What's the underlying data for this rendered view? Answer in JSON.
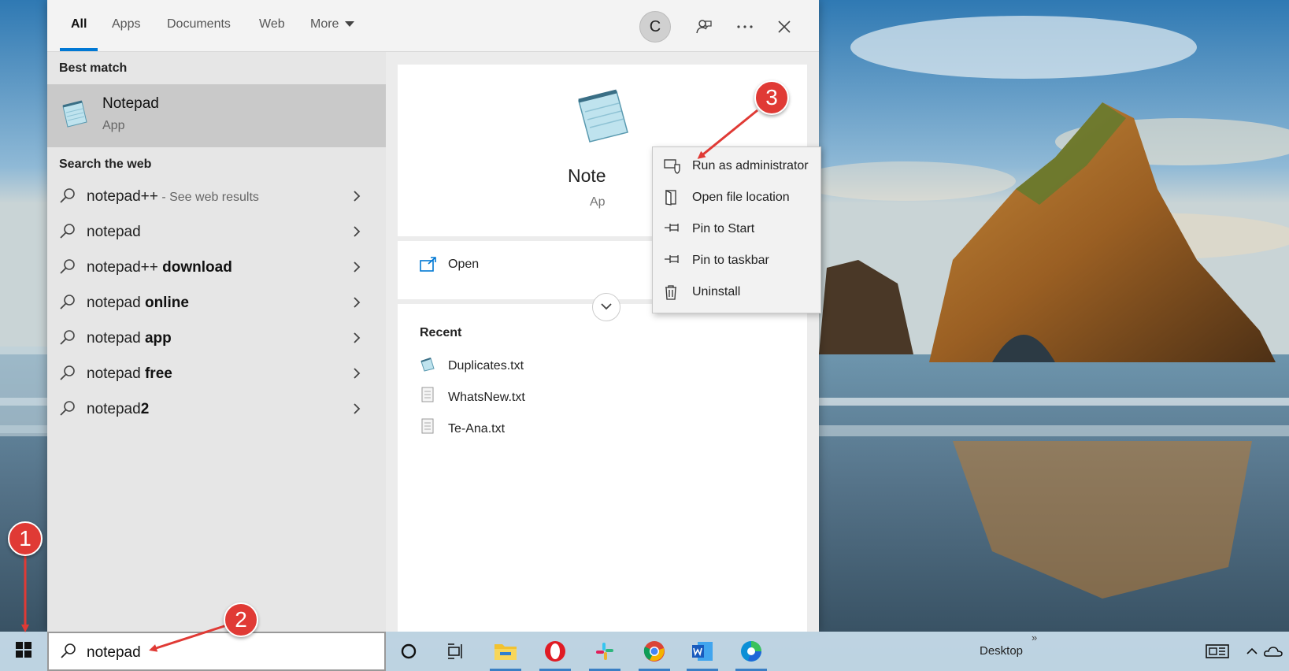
{
  "search_panel": {
    "tabs": [
      {
        "label": "All",
        "active": true
      },
      {
        "label": "Apps"
      },
      {
        "label": "Documents"
      },
      {
        "label": "Web"
      },
      {
        "label": "More"
      }
    ],
    "user_initial": "C",
    "best_match_heading": "Best match",
    "best_match": {
      "title": "Notepad",
      "subtitle": "App",
      "icon": "notepad-icon"
    },
    "search_web_heading": "Search the web",
    "web_results": [
      {
        "prefix": "notepad++",
        "bold": "",
        "hint": " - See web results"
      },
      {
        "prefix": "notepad",
        "bold": "",
        "hint": ""
      },
      {
        "prefix": "notepad++ ",
        "bold": "download",
        "hint": ""
      },
      {
        "prefix": "notepad ",
        "bold": "online",
        "hint": ""
      },
      {
        "prefix": "notepad ",
        "bold": "app",
        "hint": ""
      },
      {
        "prefix": "notepad ",
        "bold": "free",
        "hint": ""
      },
      {
        "prefix": "notepad",
        "bold": "2",
        "hint": ""
      }
    ]
  },
  "preview": {
    "app_name": "Note",
    "app_type": "Ap",
    "open_label": "Open",
    "recent_heading": "Recent",
    "recent_files": [
      {
        "name": "Duplicates.txt",
        "icon": "notepad-file-icon"
      },
      {
        "name": "WhatsNew.txt",
        "icon": "text-file-icon"
      },
      {
        "name": "Te-Ana.txt",
        "icon": "text-file-icon"
      }
    ]
  },
  "context_menu": {
    "items": [
      {
        "label": "Run as administrator",
        "icon": "shield-icon"
      },
      {
        "label": "Open file location",
        "icon": "folder-location-icon"
      },
      {
        "label": "Pin to Start",
        "icon": "pin-icon"
      },
      {
        "label": "Pin to taskbar",
        "icon": "pin-icon"
      },
      {
        "label": "Uninstall",
        "icon": "trash-icon"
      }
    ]
  },
  "taskbar": {
    "search_value": "notepad",
    "desktop_label": "Desktop",
    "chevron": "»",
    "apps": [
      "cortana",
      "task-view",
      "file-explorer",
      "opera",
      "slack",
      "chrome",
      "word",
      "edge"
    ]
  },
  "annotations": {
    "badge1": "1",
    "badge2": "2",
    "badge3": "3",
    "color": "#e03a35"
  }
}
